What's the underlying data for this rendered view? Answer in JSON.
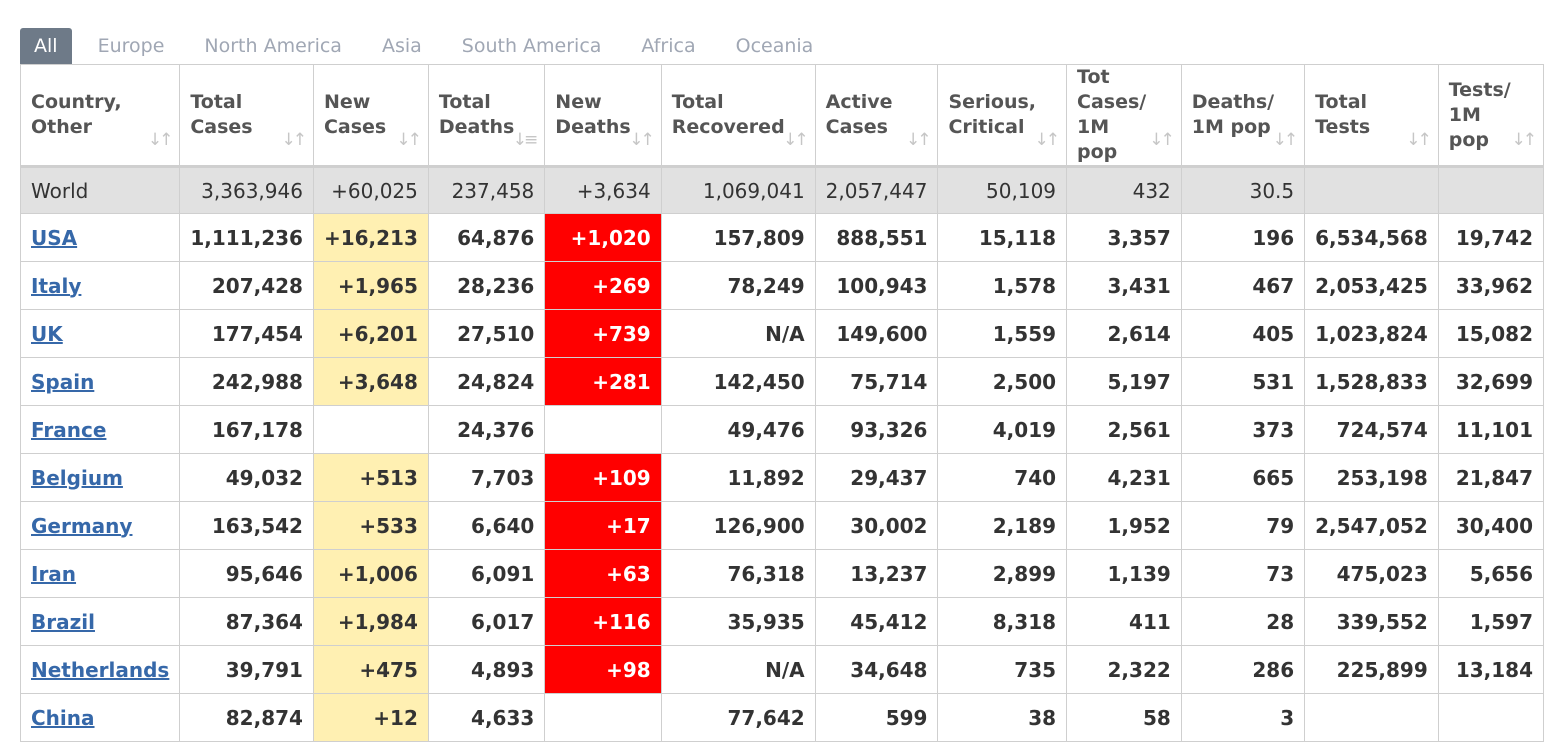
{
  "tabs": [
    "All",
    "Europe",
    "North America",
    "Asia",
    "South America",
    "Africa",
    "Oceania"
  ],
  "active_tab": "All",
  "columns": [
    {
      "line1": "Country,",
      "line2": "Other"
    },
    {
      "line1": "Total",
      "line2": "Cases"
    },
    {
      "line1": "New",
      "line2": "Cases"
    },
    {
      "line1": "Total",
      "line2": "Deaths"
    },
    {
      "line1": "New",
      "line2": "Deaths"
    },
    {
      "line1": "Total",
      "line2": "Recovered"
    },
    {
      "line1": "Active",
      "line2": "Cases"
    },
    {
      "line1": "Serious,",
      "line2": "Critical"
    },
    {
      "line1": "Tot Cases/",
      "line2": "1M pop"
    },
    {
      "line1": "Deaths/",
      "line2": "1M pop"
    },
    {
      "line1": "Total",
      "line2": "Tests"
    },
    {
      "line1": "Tests/",
      "line2": "1M pop"
    }
  ],
  "world_row": [
    "World",
    "3,363,946",
    "+60,025",
    "237,458",
    "+3,634",
    "1,069,041",
    "2,057,447",
    "50,109",
    "432",
    "30.5",
    "",
    ""
  ],
  "rows": [
    [
      "USA",
      "1,111,236",
      "+16,213",
      "64,876",
      "+1,020",
      "157,809",
      "888,551",
      "15,118",
      "3,357",
      "196",
      "6,534,568",
      "19,742"
    ],
    [
      "Italy",
      "207,428",
      "+1,965",
      "28,236",
      "+269",
      "78,249",
      "100,943",
      "1,578",
      "3,431",
      "467",
      "2,053,425",
      "33,962"
    ],
    [
      "UK",
      "177,454",
      "+6,201",
      "27,510",
      "+739",
      "N/A",
      "149,600",
      "1,559",
      "2,614",
      "405",
      "1,023,824",
      "15,082"
    ],
    [
      "Spain",
      "242,988",
      "+3,648",
      "24,824",
      "+281",
      "142,450",
      "75,714",
      "2,500",
      "5,197",
      "531",
      "1,528,833",
      "32,699"
    ],
    [
      "France",
      "167,178",
      "",
      "24,376",
      "",
      "49,476",
      "93,326",
      "4,019",
      "2,561",
      "373",
      "724,574",
      "11,101"
    ],
    [
      "Belgium",
      "49,032",
      "+513",
      "7,703",
      "+109",
      "11,892",
      "29,437",
      "740",
      "4,231",
      "665",
      "253,198",
      "21,847"
    ],
    [
      "Germany",
      "163,542",
      "+533",
      "6,640",
      "+17",
      "126,900",
      "30,002",
      "2,189",
      "1,952",
      "79",
      "2,547,052",
      "30,400"
    ],
    [
      "Iran",
      "95,646",
      "+1,006",
      "6,091",
      "+63",
      "76,318",
      "13,237",
      "2,899",
      "1,139",
      "73",
      "475,023",
      "5,656"
    ],
    [
      "Brazil",
      "87,364",
      "+1,984",
      "6,017",
      "+116",
      "35,935",
      "45,412",
      "8,318",
      "411",
      "28",
      "339,552",
      "1,597"
    ],
    [
      "Netherlands",
      "39,791",
      "+475",
      "4,893",
      "+98",
      "N/A",
      "34,648",
      "735",
      "2,322",
      "286",
      "225,899",
      "13,184"
    ],
    [
      "China",
      "82,874",
      "+12",
      "4,633",
      "",
      "77,642",
      "599",
      "38",
      "58",
      "3",
      "",
      ""
    ]
  ],
  "colors": {
    "new_cases_bg": "#fff0b2",
    "new_deaths_bg": "#ff0000",
    "world_bg": "#e1e1e1",
    "link": "#3668a9",
    "tab_active_bg": "#6e7a88"
  }
}
